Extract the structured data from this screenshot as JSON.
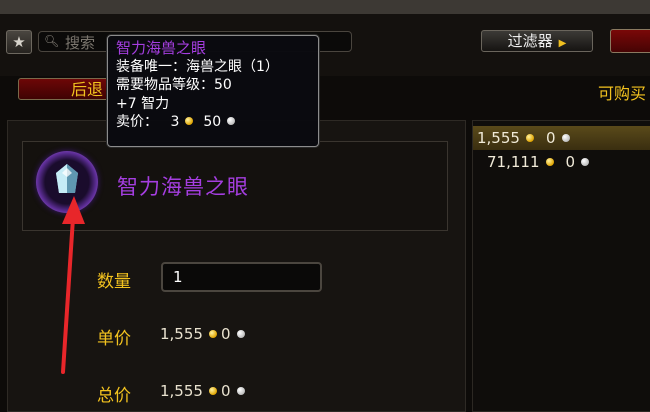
{
  "search": {
    "placeholder": "搜索"
  },
  "toolbar": {
    "filter_label": "过滤器"
  },
  "nav": {
    "back_label": "后退",
    "buyable_label": "可购买"
  },
  "item": {
    "name": "智力海兽之眼"
  },
  "tooltip": {
    "title": "智力海兽之眼",
    "unique_line": "装备唯一：海兽之眼（1）",
    "level_line": "需要物品等级：50",
    "stat_line": "+7 智力",
    "sell_label": "卖价：",
    "sell_gold": "3",
    "sell_silver": "50"
  },
  "purchase": {
    "quantity_label": "数量",
    "quantity_value": "1",
    "unit_price_label": "单价",
    "unit_gold": "1,555",
    "unit_silver": "0",
    "total_label": "总价",
    "total_gold": "1,555",
    "total_silver": "0"
  },
  "results": [
    {
      "gold": "1,555",
      "silver": "0",
      "selected": true
    },
    {
      "gold": "71,111",
      "silver": "0",
      "selected": false
    }
  ],
  "colors": {
    "epic_purple": "#a53ee0",
    "label_gold": "#f2c21f",
    "annotation_arrow": "#e8262a"
  },
  "icons": {
    "favorite": "star-icon",
    "search": "search-icon",
    "filter_expand": "triangle-right-icon",
    "item": "gem-icon"
  }
}
